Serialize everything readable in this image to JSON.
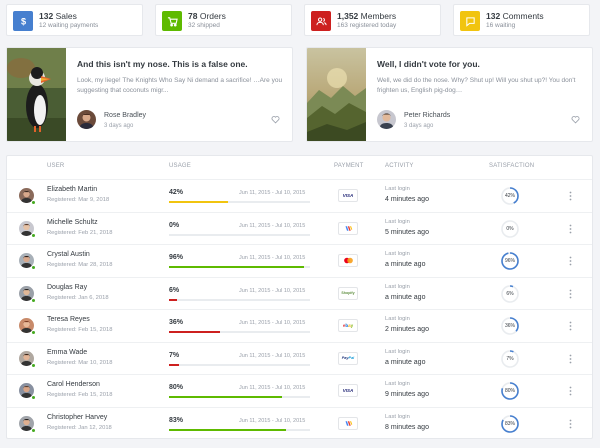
{
  "stats": [
    {
      "value": "132",
      "label": "Sales",
      "sub": "12 waiting payments",
      "color": "#467fcf",
      "icon": "dollar-icon"
    },
    {
      "value": "78",
      "label": "Orders",
      "sub": "32 shipped",
      "color": "#5eba00",
      "icon": "cart-icon"
    },
    {
      "value": "1,352",
      "label": "Members",
      "sub": "163 registered today",
      "color": "#cd201f",
      "icon": "users-icon"
    },
    {
      "value": "132",
      "label": "Comments",
      "sub": "16 waiting",
      "color": "#f1c40f",
      "icon": "message-icon"
    }
  ],
  "posts": [
    {
      "title": "And this isn't my nose. This is a false one.",
      "desc": "Look, my liege! The Knights Who Say Ni demand a sacrifice! …Are you suggesting that coconuts migr...",
      "author": "Rose Bradley",
      "ago": "3 days ago",
      "image": "puffin-photo"
    },
    {
      "title": "Well, I didn't vote for you.",
      "desc": "Well, we did do the nose. Why? Shut up! Will you shut up?! You don't frighten us, English pig-dog…",
      "author": "Peter Richards",
      "ago": "3 days ago",
      "image": "mountain-landscape-photo"
    }
  ],
  "table": {
    "headers": {
      "user": "USER",
      "usage": "USAGE",
      "payment": "PAYMENT",
      "activity": "ACTIVITY",
      "satisfaction": "SATISFACTION"
    },
    "rows": [
      {
        "name": "Elizabeth Martin",
        "registered": "Registered: Mar 9, 2018",
        "usage_pct": "42%",
        "usage_value": 42,
        "range": "Jun 11, 2015 - Jul 10, 2015",
        "bar_color": "#f1c40f",
        "payment": "VISA",
        "activity_label": "Last login",
        "activity": "4 minutes ago",
        "satisfaction": "42%",
        "satisfaction_value": 42
      },
      {
        "name": "Michelle Schultz",
        "registered": "Registered: Feb 21, 2018",
        "usage_pct": "0%",
        "usage_value": 0,
        "range": "Jun 11, 2015 - Jul 10, 2015",
        "bar_color": "#cd201f",
        "payment": "Google Wallet",
        "activity_label": "Last login",
        "activity": "5 minutes ago",
        "satisfaction": "0%",
        "satisfaction_value": 0
      },
      {
        "name": "Crystal Austin",
        "registered": "Registered: Mar 28, 2018",
        "usage_pct": "96%",
        "usage_value": 96,
        "range": "Jun 11, 2015 - Jul 10, 2015",
        "bar_color": "#5eba00",
        "payment": "MasterCard",
        "activity_label": "Last login",
        "activity": "a minute ago",
        "satisfaction": "96%",
        "satisfaction_value": 96
      },
      {
        "name": "Douglas Ray",
        "registered": "Registered: Jan 6, 2018",
        "usage_pct": "6%",
        "usage_value": 6,
        "range": "Jun 11, 2015 - Jul 10, 2015",
        "bar_color": "#cd201f",
        "payment": "Shopify",
        "activity_label": "Last login",
        "activity": "a minute ago",
        "satisfaction": "6%",
        "satisfaction_value": 6
      },
      {
        "name": "Teresa Reyes",
        "registered": "Registered: Feb 15, 2018",
        "usage_pct": "36%",
        "usage_value": 36,
        "range": "Jun 11, 2015 - Jul 10, 2015",
        "bar_color": "#cd201f",
        "payment": "ebay",
        "activity_label": "Last login",
        "activity": "2 minutes ago",
        "satisfaction": "36%",
        "satisfaction_value": 36
      },
      {
        "name": "Emma Wade",
        "registered": "Registered: Mar 10, 2018",
        "usage_pct": "7%",
        "usage_value": 7,
        "range": "Jun 11, 2015 - Jul 10, 2015",
        "bar_color": "#cd201f",
        "payment": "PayPal",
        "activity_label": "Last login",
        "activity": "a minute ago",
        "satisfaction": "7%",
        "satisfaction_value": 7
      },
      {
        "name": "Carol Henderson",
        "registered": "Registered: Feb 15, 2018",
        "usage_pct": "80%",
        "usage_value": 80,
        "range": "Jun 11, 2015 - Jul 10, 2015",
        "bar_color": "#5eba00",
        "payment": "VISA",
        "activity_label": "Last login",
        "activity": "9 minutes ago",
        "satisfaction": "80%",
        "satisfaction_value": 80
      },
      {
        "name": "Christopher Harvey",
        "registered": "Registered: Jan 12, 2018",
        "usage_pct": "83%",
        "usage_value": 83,
        "range": "Jun 11, 2015 - Jul 10, 2015",
        "bar_color": "#5eba00",
        "payment": "Google Wallet",
        "activity_label": "Last login",
        "activity": "8 minutes ago",
        "satisfaction": "83%",
        "satisfaction_value": 83
      }
    ]
  },
  "colors": {
    "accent": "#467fcf",
    "online": "#45aa20"
  }
}
